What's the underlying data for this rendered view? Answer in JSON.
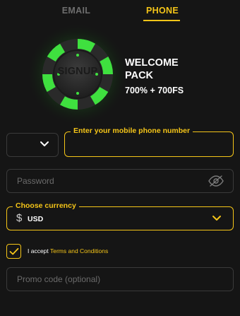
{
  "tabs": {
    "email": "EMAIL",
    "phone": "PHONE",
    "active": "PHONE"
  },
  "promo": {
    "chip_text": "SIGNUP",
    "title_line1": "WELCOME",
    "title_line2": "PACK",
    "offer": "700% + 700FS"
  },
  "form": {
    "country_code": {
      "value": "",
      "icon": "chevron-down-icon"
    },
    "phone": {
      "label": "Enter your mobile phone number",
      "value": ""
    },
    "password": {
      "placeholder": "Password",
      "value": "",
      "icon": "eye-off-icon"
    },
    "currency": {
      "label": "Choose currency",
      "value": "USD",
      "icon": "dollar-icon",
      "dollar_glyph": "$"
    },
    "terms": {
      "checked": true,
      "prefix": "I accept ",
      "link": "Terms and Conditions"
    },
    "promo_code": {
      "placeholder": "Promo code (optional)",
      "value": ""
    }
  },
  "colors": {
    "background": "#151515",
    "accent": "#f5c518",
    "chip_green": "#2fd12f",
    "border": "#3a3a3a",
    "muted_text": "#6e6e6e"
  }
}
